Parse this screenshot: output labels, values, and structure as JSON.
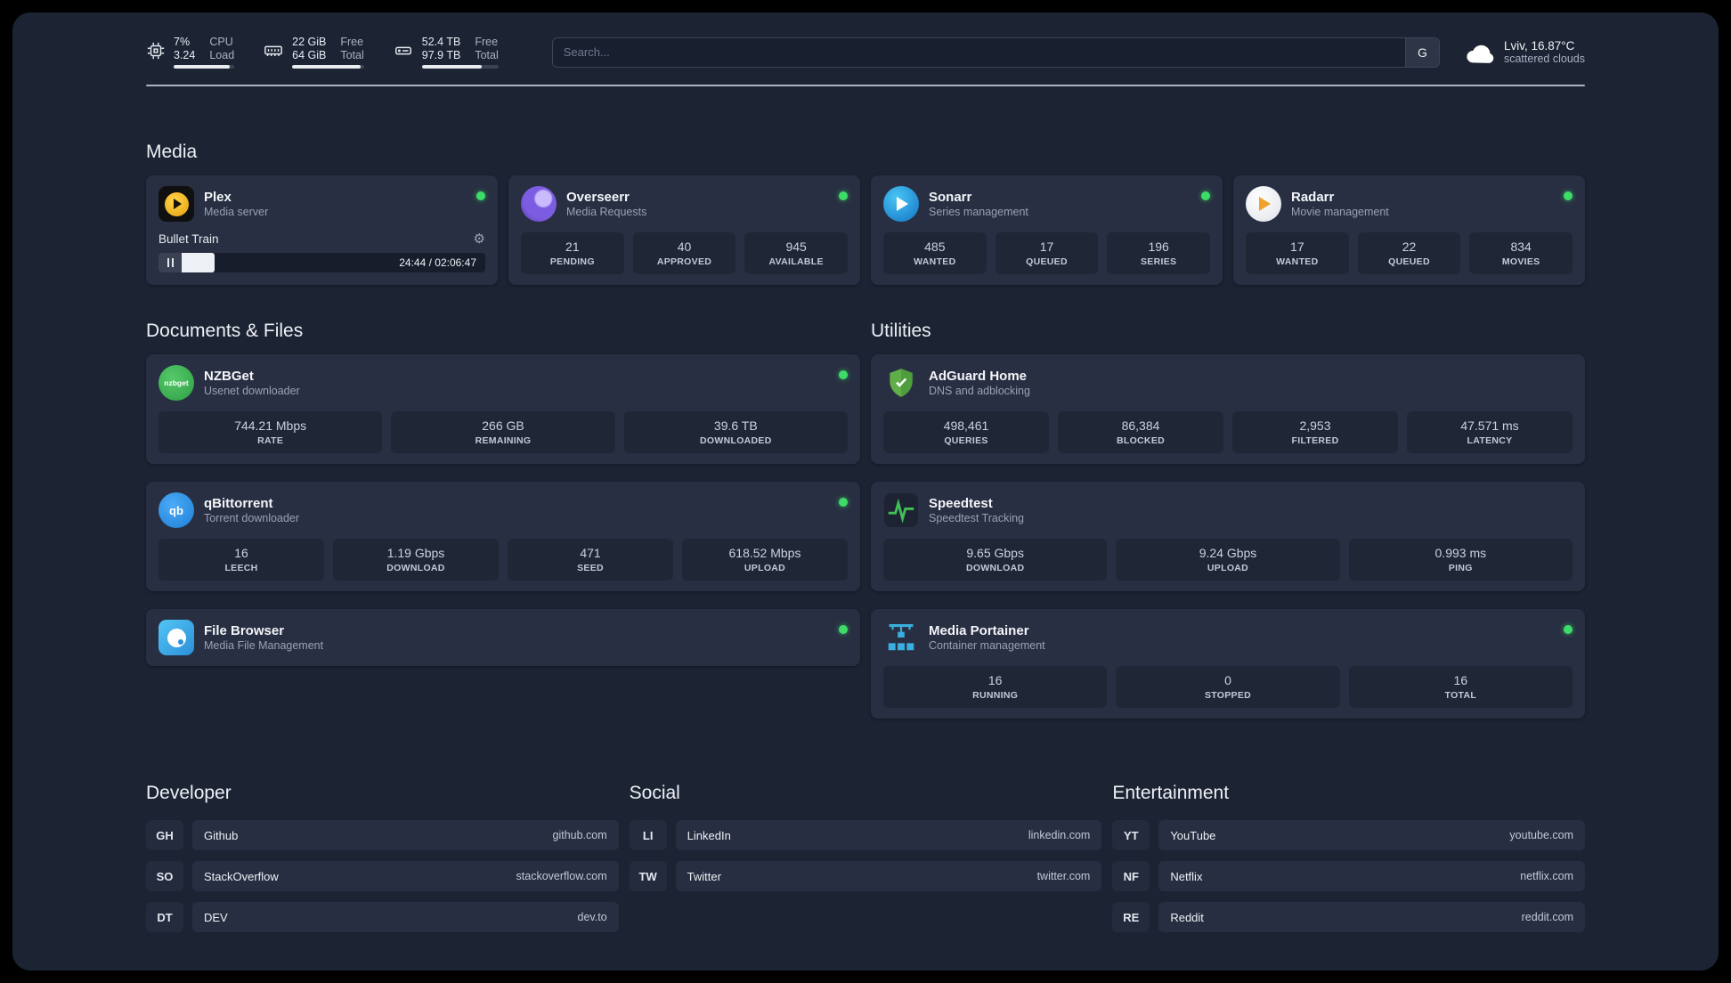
{
  "palette": {
    "background": "#1c2333",
    "card": "#282f42",
    "stat_box": "#1f2636",
    "status_online": "#3ddc68",
    "text_primary": "#f1f3f5",
    "text_secondary": "#99a1b4"
  },
  "topbar": {
    "cpu": {
      "value_top": "7%",
      "value_bottom": "3.24",
      "label_top": "CPU",
      "label_bottom": "Load",
      "bar_style": "width:92%"
    },
    "ram": {
      "value_top": "22 GiB",
      "value_bottom": "64 GiB",
      "label_top": "Free",
      "label_bottom": "Total",
      "bar_style": "width:95%"
    },
    "disk": {
      "value_top": "52.4 TB",
      "value_bottom": "97.9 TB",
      "label_top": "Free",
      "label_bottom": "Total",
      "bar_style": "width:78%"
    },
    "search": {
      "placeholder": "Search...",
      "engine_label": "G"
    },
    "weather": {
      "location": "Lviv, 16.87°C",
      "condition": "scattered clouds"
    }
  },
  "sections": {
    "media": {
      "title": "Media"
    },
    "documents": {
      "title": "Documents & Files"
    },
    "utilities": {
      "title": "Utilities"
    },
    "developer": {
      "title": "Developer"
    },
    "social": {
      "title": "Social"
    },
    "entertainment": {
      "title": "Entertainment"
    }
  },
  "apps": {
    "plex": {
      "name": "Plex",
      "subtitle": "Media server",
      "now_playing": "Bullet Train",
      "time": "24:44 / 02:06:47",
      "progress_style": "width:16%"
    },
    "overseerr": {
      "name": "Overseerr",
      "subtitle": "Media Requests",
      "stats": [
        {
          "value": "21",
          "label": "PENDING"
        },
        {
          "value": "40",
          "label": "APPROVED"
        },
        {
          "value": "945",
          "label": "AVAILABLE"
        }
      ]
    },
    "sonarr": {
      "name": "Sonarr",
      "subtitle": "Series management",
      "stats": [
        {
          "value": "485",
          "label": "WANTED"
        },
        {
          "value": "17",
          "label": "QUEUED"
        },
        {
          "value": "196",
          "label": "SERIES"
        }
      ]
    },
    "radarr": {
      "name": "Radarr",
      "subtitle": "Movie management",
      "stats": [
        {
          "value": "17",
          "label": "WANTED"
        },
        {
          "value": "22",
          "label": "QUEUED"
        },
        {
          "value": "834",
          "label": "MOVIES"
        }
      ]
    },
    "nzbget": {
      "name": "NZBGet",
      "subtitle": "Usenet downloader",
      "icon_text": "nzbget",
      "stats": [
        {
          "value": "744.21 Mbps",
          "label": "RATE"
        },
        {
          "value": "266 GB",
          "label": "REMAINING"
        },
        {
          "value": "39.6 TB",
          "label": "DOWNLOADED"
        }
      ]
    },
    "qbittorrent": {
      "name": "qBittorrent",
      "subtitle": "Torrent downloader",
      "icon_text": "qb",
      "stats": [
        {
          "value": "16",
          "label": "LEECH"
        },
        {
          "value": "1.19 Gbps",
          "label": "DOWNLOAD"
        },
        {
          "value": "471",
          "label": "SEED"
        },
        {
          "value": "618.52 Mbps",
          "label": "UPLOAD"
        }
      ]
    },
    "filebrowser": {
      "name": "File Browser",
      "subtitle": "Media File Management"
    },
    "adguard": {
      "name": "AdGuard Home",
      "subtitle": "DNS and adblocking",
      "stats": [
        {
          "value": "498,461",
          "label": "QUERIES"
        },
        {
          "value": "86,384",
          "label": "BLOCKED"
        },
        {
          "value": "2,953",
          "label": "FILTERED"
        },
        {
          "value": "47.571 ms",
          "label": "LATENCY"
        }
      ]
    },
    "speedtest": {
      "name": "Speedtest",
      "subtitle": "Speedtest Tracking",
      "stats": [
        {
          "value": "9.65 Gbps",
          "label": "DOWNLOAD"
        },
        {
          "value": "9.24 Gbps",
          "label": "UPLOAD"
        },
        {
          "value": "0.993 ms",
          "label": "PING"
        }
      ]
    },
    "portainer": {
      "name": "Media Portainer",
      "subtitle": "Container management",
      "stats": [
        {
          "value": "16",
          "label": "RUNNING"
        },
        {
          "value": "0",
          "label": "STOPPED"
        },
        {
          "value": "16",
          "label": "TOTAL"
        }
      ]
    }
  },
  "bookmarks": {
    "developer": [
      {
        "abbr": "GH",
        "name": "Github",
        "url": "github.com"
      },
      {
        "abbr": "SO",
        "name": "StackOverflow",
        "url": "stackoverflow.com"
      },
      {
        "abbr": "DT",
        "name": "DEV",
        "url": "dev.to"
      }
    ],
    "social": [
      {
        "abbr": "LI",
        "name": "LinkedIn",
        "url": "linkedin.com"
      },
      {
        "abbr": "TW",
        "name": "Twitter",
        "url": "twitter.com"
      }
    ],
    "entertainment": [
      {
        "abbr": "YT",
        "name": "YouTube",
        "url": "youtube.com"
      },
      {
        "abbr": "NF",
        "name": "Netflix",
        "url": "netflix.com"
      },
      {
        "abbr": "RE",
        "name": "Reddit",
        "url": "reddit.com"
      }
    ]
  }
}
